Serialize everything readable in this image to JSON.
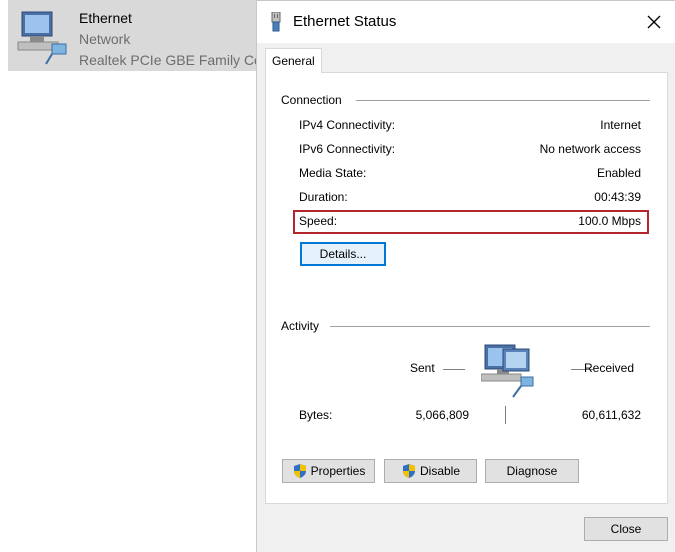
{
  "background": {
    "adapter": {
      "name": "Ethernet",
      "status": "Network",
      "device": "Realtek PCIe GBE Family Co",
      "icon": "network-adapter-icon"
    }
  },
  "dialog": {
    "title": "Ethernet Status",
    "title_icon": "ethernet-port-icon",
    "tab": "General",
    "connection": {
      "heading": "Connection",
      "rows": [
        {
          "label": "IPv4 Connectivity:",
          "value": "Internet"
        },
        {
          "label": "IPv6 Connectivity:",
          "value": "No network access"
        },
        {
          "label": "Media State:",
          "value": "Enabled"
        },
        {
          "label": "Duration:",
          "value": "00:43:39"
        },
        {
          "label": "Speed:",
          "value": "100.0 Mbps"
        }
      ],
      "details_button": "Details..."
    },
    "activity": {
      "heading": "Activity",
      "sent_label": "Sent",
      "received_label": "Received",
      "bytes_label": "Bytes:",
      "bytes_sent": "5,066,809",
      "bytes_received": "60,611,632"
    },
    "buttons": {
      "properties": "Properties",
      "disable": "Disable",
      "diagnose": "Diagnose",
      "close": "Close"
    },
    "colors": {
      "highlight": "#b3262e",
      "focus": "#0078d7"
    }
  }
}
